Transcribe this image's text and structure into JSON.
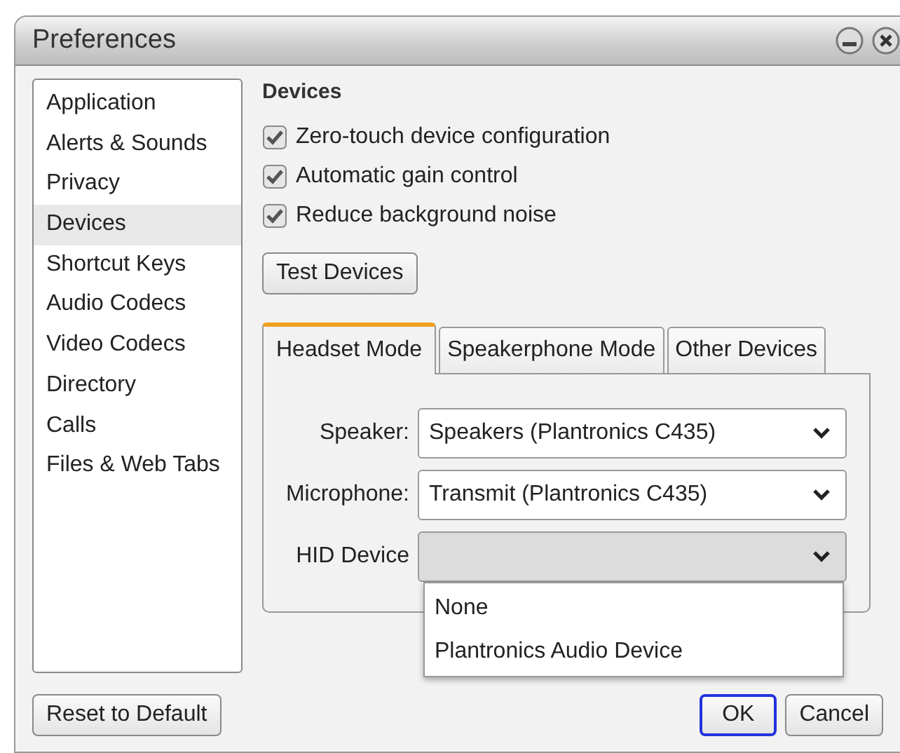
{
  "window": {
    "title": "Preferences"
  },
  "sidebar": {
    "items": [
      {
        "label": "Application",
        "selected": false
      },
      {
        "label": "Alerts & Sounds",
        "selected": false
      },
      {
        "label": "Privacy",
        "selected": false
      },
      {
        "label": "Devices",
        "selected": true
      },
      {
        "label": "Shortcut Keys",
        "selected": false
      },
      {
        "label": "Audio Codecs",
        "selected": false
      },
      {
        "label": "Video Codecs",
        "selected": false
      },
      {
        "label": "Directory",
        "selected": false
      },
      {
        "label": "Calls",
        "selected": false
      },
      {
        "label": "Files & Web Tabs",
        "selected": false
      }
    ]
  },
  "section": {
    "title": "Devices"
  },
  "checkboxes": [
    {
      "label": "Zero-touch device configuration",
      "checked": true
    },
    {
      "label": "Automatic gain control",
      "checked": true
    },
    {
      "label": "Reduce background noise",
      "checked": true
    }
  ],
  "test_button": {
    "label": "Test Devices"
  },
  "tabs": [
    {
      "label": "Headset Mode",
      "selected": true
    },
    {
      "label": "Speakerphone Mode",
      "selected": false
    },
    {
      "label": "Other Devices",
      "selected": false
    }
  ],
  "fields": [
    {
      "label": "Speaker:",
      "value": "Speakers (Plantronics C435)",
      "open": false
    },
    {
      "label": "Microphone:",
      "value": "Transmit (Plantronics C435)",
      "open": false
    },
    {
      "label": "HID Device",
      "open": true,
      "options": [
        "None",
        "Plantronics Audio Device"
      ]
    }
  ],
  "footer": {
    "left_buttons": [
      {
        "label": "Reset to Default",
        "focused": false
      }
    ],
    "right_buttons": [
      {
        "label": "OK",
        "focused": true
      },
      {
        "label": "Cancel",
        "focused": false
      }
    ]
  }
}
